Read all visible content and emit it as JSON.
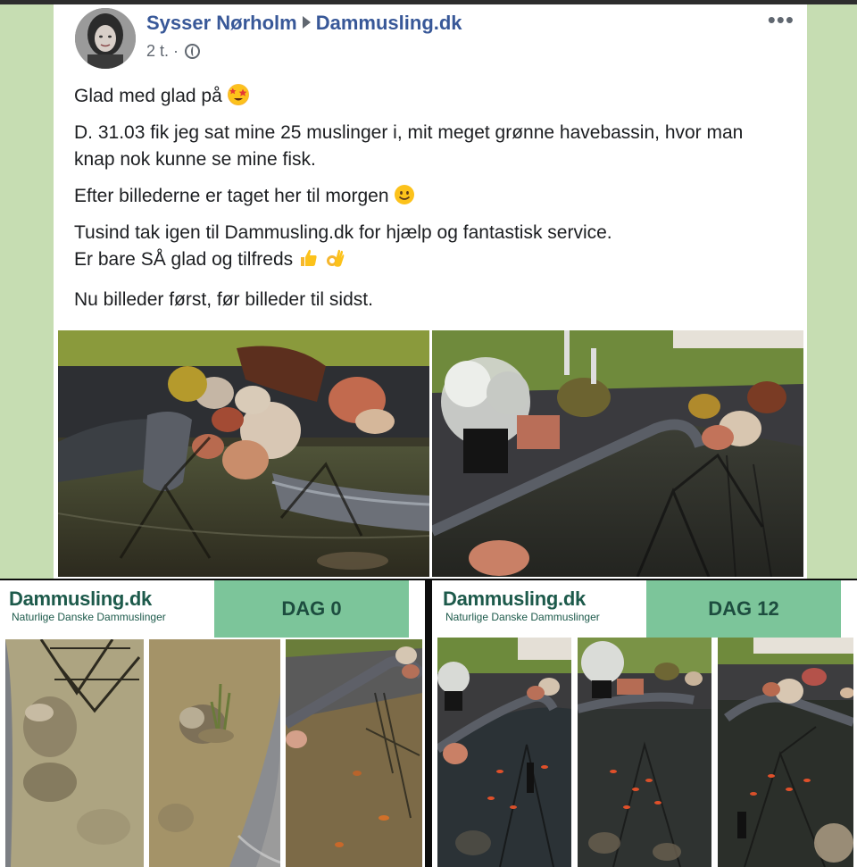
{
  "post": {
    "author": "Sysser Nørholm",
    "group": "Dammusling.dk",
    "time": "2 t. ·",
    "more_icon": "more-dots-icon",
    "paragraphs": {
      "p1": "Glad med glad på",
      "p2": "D. 31.03 fik jeg sat mine 25 muslinger i, mit meget grønne havebassin, hvor man knap nok kunne se mine fisk.",
      "p3": "Efter billederne er taget her til morgen",
      "p4a": "Tusind tak igen til Dammusling.dk for hjælp og fantastisk service.",
      "p4b": "Er bare SÅ glad og tilfreds",
      "p5": "Nu billeder først, før billeder til sidst."
    }
  },
  "panels": {
    "before": {
      "brand_name": "Dammusling.dk",
      "brand_tagline": "Naturlige Danske Dammuslinger",
      "day_label": "DAG 0"
    },
    "after": {
      "brand_name": "Dammusling.dk",
      "brand_tagline": "Naturlige Danske Dammuslinger",
      "day_label": "DAG 12"
    }
  },
  "colors": {
    "facebook_link": "#385898",
    "brand_green": "#1d5a4b",
    "badge_green": "#7cc59a",
    "page_background": "#c6ddb2"
  }
}
